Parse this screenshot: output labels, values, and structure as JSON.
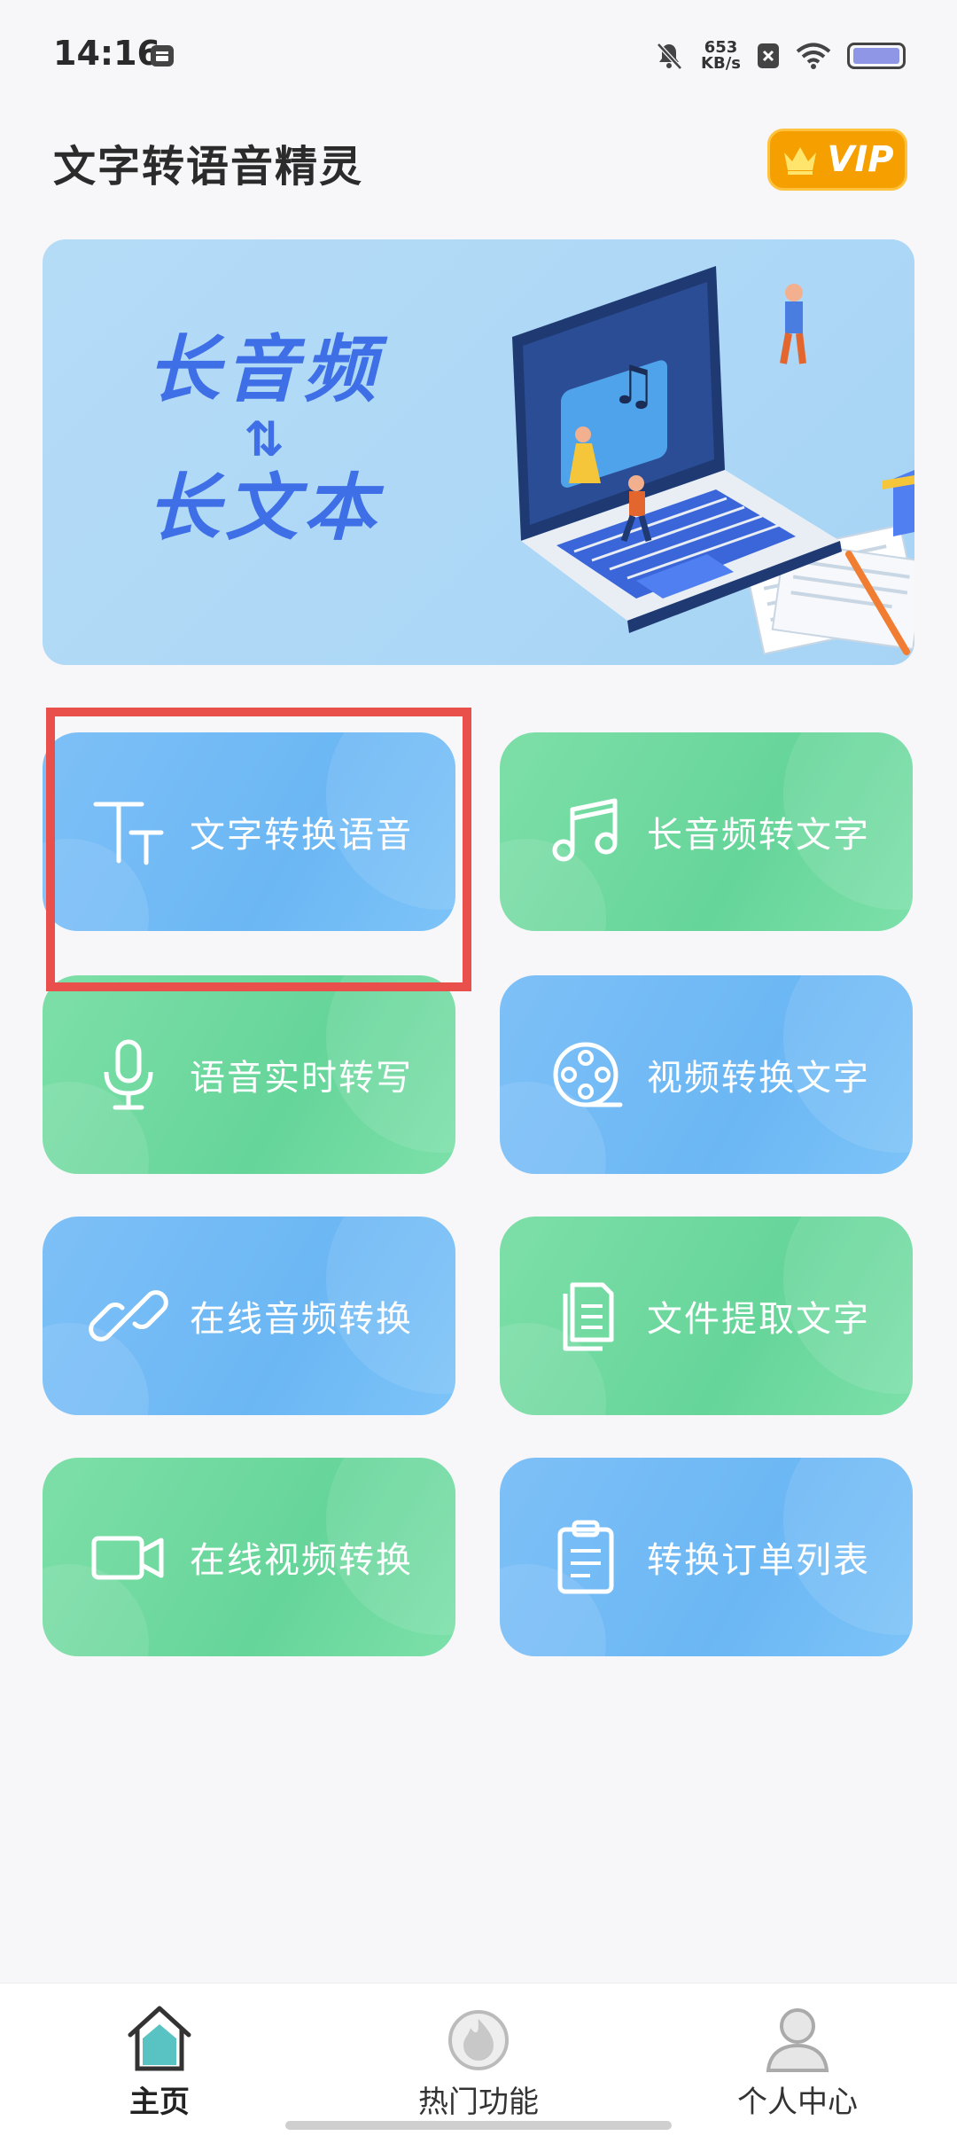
{
  "status_bar": {
    "time": "14:16",
    "net_speed_value": "653",
    "net_speed_unit": "KB/s"
  },
  "header": {
    "title": "文字转语音精灵",
    "vip_label": "VIP"
  },
  "banner": {
    "line1": "长音频",
    "arrows": "⇅",
    "line2": "长文本"
  },
  "features": [
    {
      "label": "文字转换语音",
      "icon": "text-size-icon",
      "color": "blue"
    },
    {
      "label": "长音频转文字",
      "icon": "music-note-icon",
      "color": "green"
    },
    {
      "label": "语音实时转写",
      "icon": "microphone-icon",
      "color": "green"
    },
    {
      "label": "视频转换文字",
      "icon": "film-reel-icon",
      "color": "blue"
    },
    {
      "label": "在线音频转换",
      "icon": "link-icon",
      "color": "blue"
    },
    {
      "label": "文件提取文字",
      "icon": "documents-icon",
      "color": "green"
    },
    {
      "label": "在线视频转换",
      "icon": "video-camera-icon",
      "color": "green"
    },
    {
      "label": "转换订单列表",
      "icon": "clipboard-icon",
      "color": "blue"
    }
  ],
  "bottom_nav": {
    "items": [
      {
        "label": "主页",
        "icon": "home-icon",
        "active": true
      },
      {
        "label": "热门功能",
        "icon": "fire-icon",
        "active": false
      },
      {
        "label": "个人中心",
        "icon": "person-icon",
        "active": false
      }
    ]
  },
  "colors": {
    "card_blue": "#6bb7f4",
    "card_green": "#66d59a",
    "vip_orange": "#f5a000",
    "highlight_red": "#e94f4b",
    "banner_text": "#3e6fe6"
  }
}
